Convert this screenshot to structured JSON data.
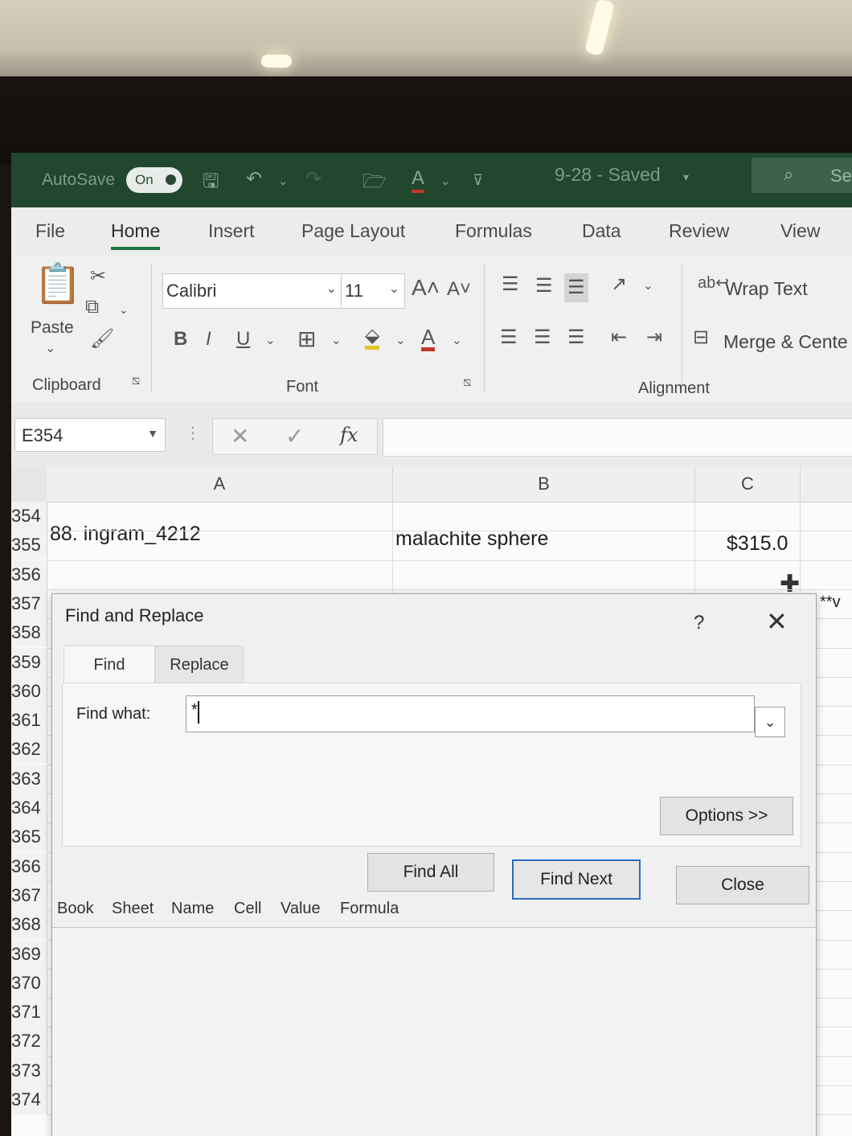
{
  "titlebar": {
    "autosave_label": "AutoSave",
    "autosave_state": "On",
    "doc_title": "9-28 - Saved",
    "search_text": "Se"
  },
  "ribbon_tabs": [
    "File",
    "Home",
    "Insert",
    "Page Layout",
    "Formulas",
    "Data",
    "Review",
    "View"
  ],
  "active_tab": "Home",
  "ribbon": {
    "paste_label": "Paste",
    "font_name": "Calibri",
    "font_size": "11",
    "bold": "B",
    "italic": "I",
    "underline": "U",
    "wrap_text": "Wrap Text",
    "merge_center": "Merge & Cente",
    "groups": {
      "clipboard": "Clipboard",
      "font": "Font",
      "alignment": "Alignment"
    }
  },
  "formula_bar": {
    "name_box": "E354",
    "fx": "fx",
    "value": ""
  },
  "sheet": {
    "columns": [
      "A",
      "B",
      "C"
    ],
    "rows": [
      "354",
      "355",
      "356",
      "357",
      "358",
      "359",
      "360",
      "361",
      "362",
      "363",
      "364",
      "365",
      "366",
      "367",
      "368",
      "369",
      "370",
      "371",
      "372",
      "373",
      "374"
    ],
    "cells": {
      "A355": "88. ingram_4212",
      "B355": "malachite sphere",
      "C355": "$315.0"
    },
    "partial_right_text": "**v"
  },
  "dialog": {
    "title": "Find and Replace",
    "help": "?",
    "tabs": [
      "Find",
      "Replace"
    ],
    "active_tab": "Find",
    "find_what_label": "Find what:",
    "find_what_value": "*",
    "options_button": "Options >>",
    "find_all_button": "Find All",
    "find_next_button": "Find Next",
    "close_button": "Close",
    "result_columns": [
      "Book",
      "Sheet",
      "Name",
      "Cell",
      "Value",
      "Formula"
    ]
  },
  "colors": {
    "titlebar": "#21472f",
    "accent": "#217346",
    "dialog_primary_border": "#2b6cc4"
  }
}
